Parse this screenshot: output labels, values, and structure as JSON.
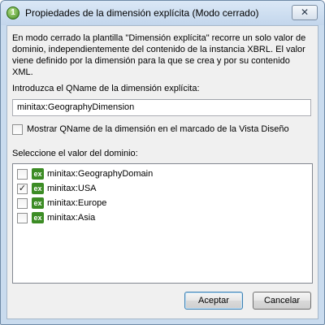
{
  "window": {
    "title": "Propiedades de la dimensión explícita (Modo cerrado)",
    "close_glyph": "✕"
  },
  "description": "En modo cerrado la plantilla \"Dimensión explícita\" recorre un solo valor de dominio, independientemente del contenido de la instancia XBRL. El valor viene definido por la dimensión para la que se crea y por su contenido XML.",
  "qname_label": "Introduzca el QName de la dimensión explícita:",
  "qname_value": "minitax:GeographyDimension",
  "show_qname": {
    "label": "Mostrar QName de la dimensión en el marcado de la Vista Diseño",
    "checked": false
  },
  "domain_label": "Seleccione el valor del dominio:",
  "domain_items": [
    {
      "badge": "ex",
      "label": "minitax:GeographyDomain",
      "checked": false,
      "mark": ""
    },
    {
      "badge": "ex",
      "label": "minitax:USA",
      "checked": true,
      "mark": "✓"
    },
    {
      "badge": "ex",
      "label": "minitax:Europe",
      "checked": false,
      "mark": ""
    },
    {
      "badge": "ex",
      "label": "minitax:Asia",
      "checked": false,
      "mark": ""
    }
  ],
  "buttons": {
    "ok": "Aceptar",
    "cancel": "Cancelar"
  }
}
